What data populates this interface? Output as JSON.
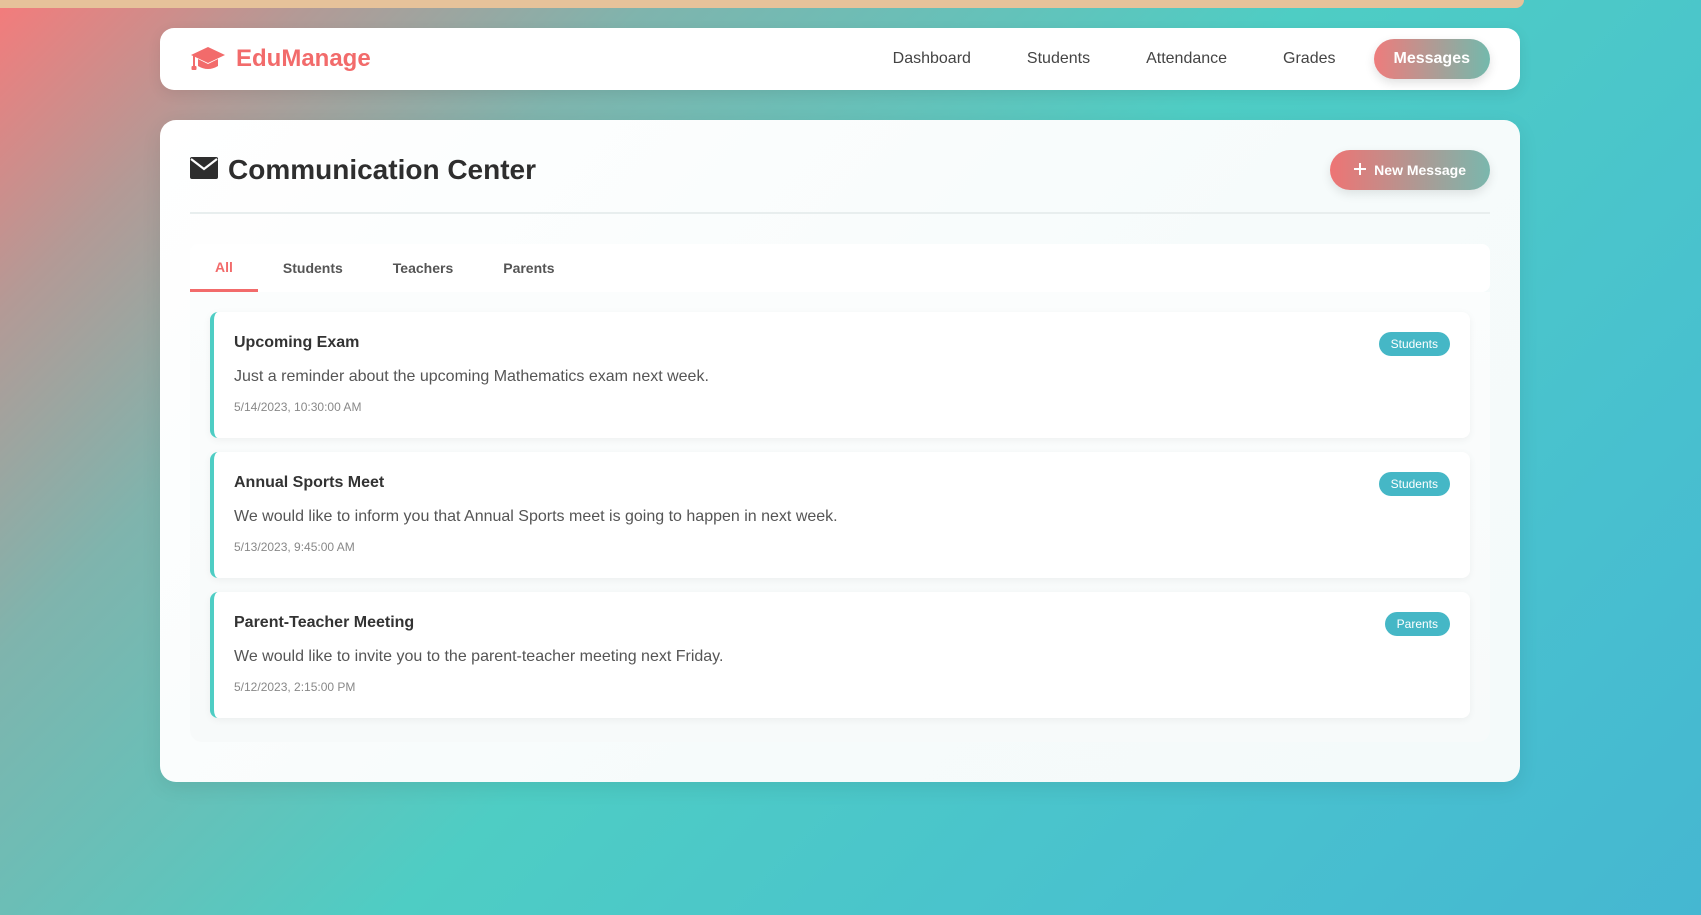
{
  "brand": {
    "name": "EduManage",
    "icon": "graduation-cap-icon",
    "color": "#f26b6b"
  },
  "nav": {
    "items": [
      {
        "label": "Dashboard",
        "active": false
      },
      {
        "label": "Students",
        "active": false
      },
      {
        "label": "Attendance",
        "active": false
      },
      {
        "label": "Grades",
        "active": false
      },
      {
        "label": "Messages",
        "active": true
      }
    ]
  },
  "page": {
    "title": "Communication Center",
    "title_icon": "envelope-icon",
    "new_message_label": "New Message",
    "new_message_icon": "plus-icon"
  },
  "tabs": [
    {
      "label": "All",
      "active": true
    },
    {
      "label": "Students",
      "active": false
    },
    {
      "label": "Teachers",
      "active": false
    },
    {
      "label": "Parents",
      "active": false
    }
  ],
  "messages": [
    {
      "title": "Upcoming Exam",
      "body": "Just a reminder about the upcoming Mathematics exam next week.",
      "time": "5/14/2023, 10:30:00 AM",
      "badge": "Students"
    },
    {
      "title": "Annual Sports Meet",
      "body": "We would like to inform you that Annual Sports meet is going to happen in next week.",
      "time": "5/13/2023, 9:45:00 AM",
      "badge": "Students"
    },
    {
      "title": "Parent-Teacher Meeting",
      "body": "We would like to invite you to the parent-teacher meeting next Friday.",
      "time": "5/12/2023, 2:15:00 PM",
      "badge": "Parents"
    }
  ],
  "colors": {
    "accent": "#f26b6b",
    "teal": "#4ecdc4",
    "badge": "#45b7c6"
  }
}
